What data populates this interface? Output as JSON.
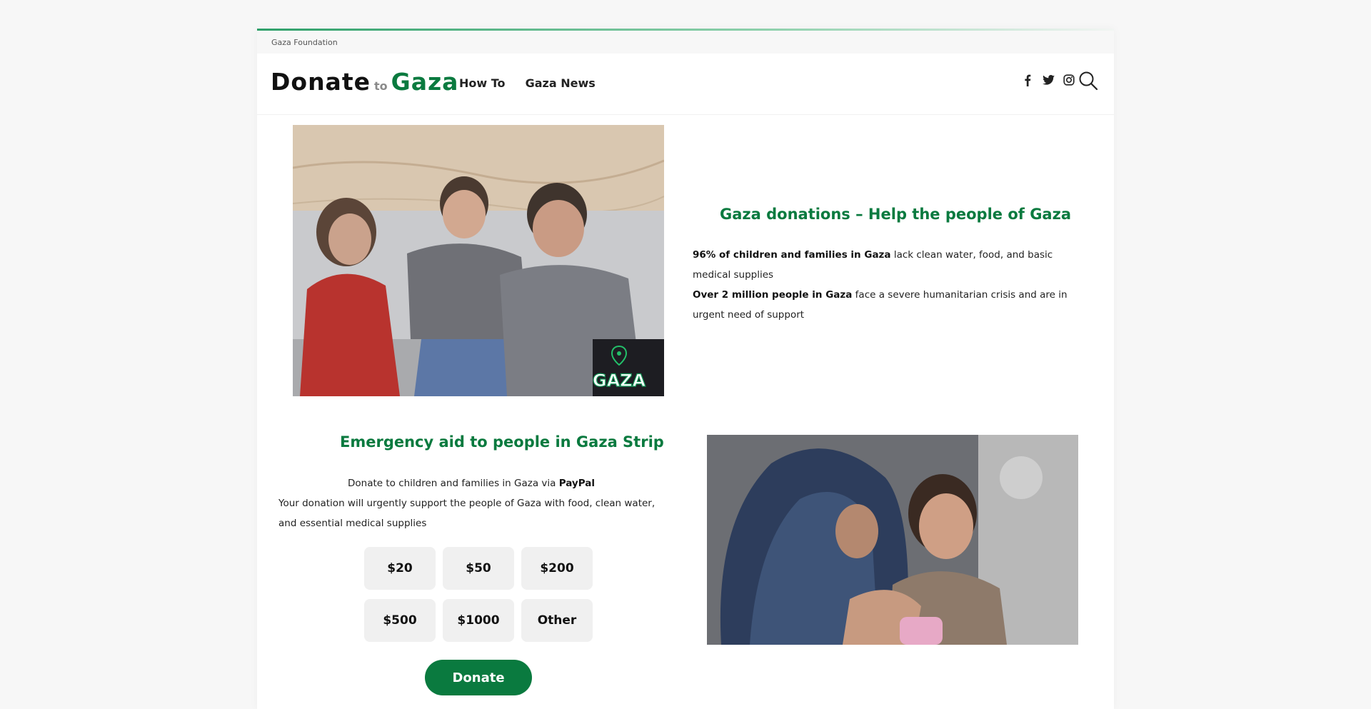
{
  "topbar": {
    "site_label": "Gaza Foundation"
  },
  "header": {
    "logo": {
      "word1": "Donate",
      "word2": "to",
      "word3": "Gaza"
    },
    "nav": [
      {
        "label": "How To"
      },
      {
        "label": "Gaza News"
      }
    ],
    "social_icons": [
      "facebook-icon",
      "twitter-icon",
      "instagram-icon"
    ],
    "search_icon": "search-icon"
  },
  "hero": {
    "image_badge": "GAZA",
    "title": "Gaza donations – Help the people of Gaza",
    "line1_bold": "96% of children and families in Gaza",
    "line1_rest": " lack clean water, food, and basic medical supplies",
    "line2_bold": "Over 2 million people in Gaza",
    "line2_rest": " face a severe humanitarian crisis and are in urgent need of support"
  },
  "donate": {
    "title": "Emergency aid to people in Gaza Strip",
    "intro_text": "Donate to children and families in Gaza via ",
    "intro_bold": "PayPal",
    "description": "Your donation will urgently support the people of Gaza with food, clean water, and essential medical supplies",
    "amounts": [
      "$20",
      "$50",
      "$200",
      "$500",
      "$1000",
      "Other"
    ],
    "button_label": "Donate"
  },
  "colors": {
    "brand_green": "#0a7a3f",
    "button_grey": "#f0f0f0",
    "text_dark": "#111111"
  }
}
